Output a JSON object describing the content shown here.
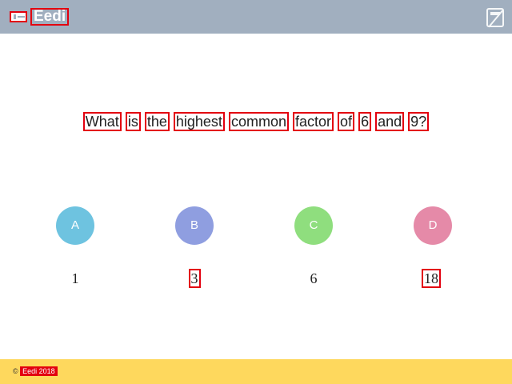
{
  "header": {
    "brand": "Eedi",
    "logo_icon": "eedi-logo-icon",
    "calculator_icon": "calculator-disabled-icon",
    "bg_color": "#a1afbf"
  },
  "question": {
    "words": [
      "What",
      "is",
      "the",
      "highest",
      "common",
      "factor",
      "of",
      "6",
      "and",
      "9?"
    ]
  },
  "options": [
    {
      "letter": "A",
      "value": "1",
      "color": "#6ec3e0"
    },
    {
      "letter": "B",
      "value": "3",
      "color": "#8f9ee0"
    },
    {
      "letter": "C",
      "value": "6",
      "color": "#8fde7e"
    },
    {
      "letter": "D",
      "value": "18",
      "color": "#e58aa8"
    }
  ],
  "footer": {
    "copyright_symbol": "©",
    "copyright_text": "Eedi 2018",
    "bg_color": "#fed85d"
  }
}
